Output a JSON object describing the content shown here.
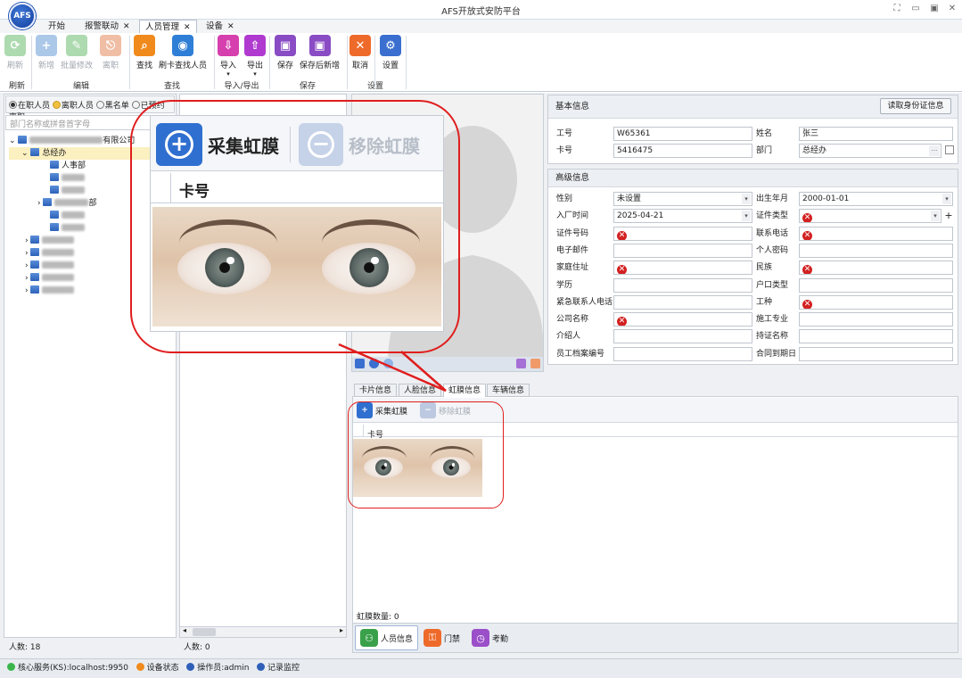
{
  "app": {
    "title": "AFS开放式安防平台",
    "logo_text": "AFS"
  },
  "window_controls": [
    "resize-icon",
    "minimize-icon",
    "maximize-icon",
    "close-icon"
  ],
  "tabs": [
    {
      "label": "开始",
      "closable": false
    },
    {
      "label": "报警联动",
      "closable": true
    },
    {
      "label": "人员管理",
      "closable": true,
      "active": true
    },
    {
      "label": "设备",
      "closable": true
    }
  ],
  "ribbon": {
    "buttons": [
      {
        "label": "刷新",
        "icon": "refresh-icon",
        "color": "#4caf50",
        "enabled": false
      },
      {
        "label": "新增",
        "icon": "add-user-icon",
        "color": "#4a86d0",
        "enabled": false
      },
      {
        "label": "批量修改",
        "icon": "batch-edit-icon",
        "color": "#4caf50",
        "enabled": false
      },
      {
        "label": "离职",
        "icon": "resign-icon",
        "color": "#e0703a",
        "enabled": false
      },
      {
        "label": "查找",
        "icon": "search-icon",
        "color": "#f08a1c",
        "enabled": true
      },
      {
        "label": "刷卡查找人员",
        "icon": "card-search-icon",
        "color": "#2f7fd6",
        "enabled": true
      },
      {
        "label": "导入",
        "icon": "import-icon",
        "color": "#d63fae",
        "enabled": true
      },
      {
        "label": "导出",
        "icon": "export-icon",
        "color": "#b03ad0",
        "enabled": true
      },
      {
        "label": "保存",
        "icon": "save-icon",
        "color": "#8a4cc4",
        "enabled": true
      },
      {
        "label": "保存后新增",
        "icon": "save-new-icon",
        "color": "#8a4cc4",
        "enabled": true
      },
      {
        "label": "取消",
        "icon": "cancel-icon",
        "color": "#ee6a2b",
        "enabled": true
      },
      {
        "label": "设置",
        "icon": "settings-icon",
        "color": "#3a6fd0",
        "enabled": true
      }
    ],
    "groups": [
      "刷新",
      "编辑",
      "查找",
      "导入/导出",
      "保存",
      "设置"
    ]
  },
  "filter": {
    "options": [
      "在职人员",
      "离职人员",
      "黑名单",
      "已预约离职"
    ],
    "selected": 0
  },
  "search": {
    "placeholder": "部门名称或拼音首字母"
  },
  "tree": {
    "root_suffix": "有限公司",
    "expanded": "总经办",
    "child1": "人事部",
    "child_suffix": "部"
  },
  "left_status": {
    "count_label": "人数: 18"
  },
  "middle_status": {
    "count_label": "人数: 0"
  },
  "callout": {
    "collect_label": "采集虹膜",
    "remove_label": "移除虹膜",
    "column": "卡号"
  },
  "basic_info": {
    "section": "基本信息",
    "read_id_button": "读取身份证信息",
    "fields": [
      {
        "label": "工号",
        "value": "W65361"
      },
      {
        "label": "姓名",
        "value": "张三"
      },
      {
        "label": "卡号",
        "value": "5416475"
      },
      {
        "label": "部门",
        "value": "总经办"
      }
    ]
  },
  "advanced_info": {
    "section": "高级信息",
    "left": [
      {
        "label": "性别",
        "value": "未设置",
        "type": "dropdown"
      },
      {
        "label": "入厂时间",
        "value": "2025-04-21",
        "type": "dropdown"
      },
      {
        "label": "证件号码",
        "value": "",
        "error": true
      },
      {
        "label": "电子邮件",
        "value": ""
      },
      {
        "label": "家庭住址",
        "value": "",
        "error": true
      },
      {
        "label": "学历",
        "value": ""
      },
      {
        "label": "紧急联系人电话",
        "value": ""
      },
      {
        "label": "公司名称",
        "value": "",
        "error": true
      },
      {
        "label": "介绍人",
        "value": ""
      },
      {
        "label": "员工档案编号",
        "value": ""
      }
    ],
    "right": [
      {
        "label": "出生年月",
        "value": "2000-01-01",
        "type": "dropdown"
      },
      {
        "label": "证件类型",
        "value": "",
        "error": true,
        "type": "dropdown"
      },
      {
        "label": "联系电话",
        "value": "",
        "error": true
      },
      {
        "label": "个人密码",
        "value": ""
      },
      {
        "label": "民族",
        "value": "",
        "error": true
      },
      {
        "label": "户口类型",
        "value": ""
      },
      {
        "label": "工种",
        "value": "",
        "error": true
      },
      {
        "label": "施工专业",
        "value": ""
      },
      {
        "label": "持证名称",
        "value": ""
      },
      {
        "label": "合同到期日",
        "value": ""
      }
    ]
  },
  "subtabs": [
    "卡片信息",
    "人脸信息",
    "虹膜信息",
    "车辆信息"
  ],
  "iris_panel": {
    "collect_label": "采集虹膜",
    "remove_label": "移除虹膜",
    "column": "卡号",
    "count_label": "虹膜数量: 0"
  },
  "modules": [
    {
      "label": "人员信息",
      "icon": "person-icon",
      "color": "#3aa14a"
    },
    {
      "label": "门禁",
      "icon": "door-icon",
      "color": "#ee6a2b"
    },
    {
      "label": "考勤",
      "icon": "clock-icon",
      "color": "#9b4fc9"
    }
  ],
  "statusbar": [
    {
      "text": "核心服务(KS):localhost:9950",
      "color": "#3bb54a"
    },
    {
      "text": "设备状态",
      "color": "#f08a1c"
    },
    {
      "text": "操作员:admin",
      "color": "#2e5fb8"
    },
    {
      "text": "记录监控",
      "color": "#2e5fb8"
    }
  ]
}
